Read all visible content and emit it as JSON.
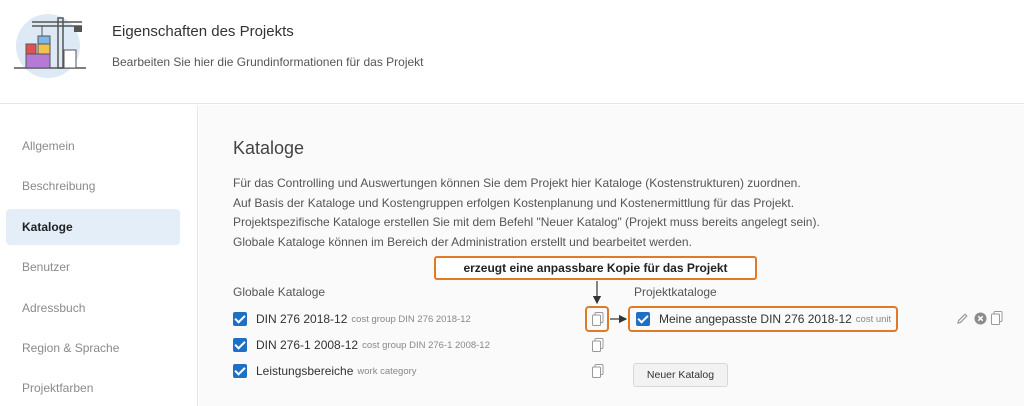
{
  "header": {
    "title": "Eigenschaften des Projekts",
    "subtitle": "Bearbeiten Sie hier die Grundinformationen für das Projekt"
  },
  "sidebar": {
    "items": [
      {
        "label": "Allgemein",
        "active": false
      },
      {
        "label": "Beschreibung",
        "active": false
      },
      {
        "label": "Kataloge",
        "active": true
      },
      {
        "label": "Benutzer",
        "active": false
      },
      {
        "label": "Adressbuch",
        "active": false
      },
      {
        "label": "Region & Sprache",
        "active": false
      },
      {
        "label": "Projektfarben",
        "active": false
      }
    ]
  },
  "main": {
    "title": "Kataloge",
    "description": [
      "Für das Controlling und Auswertungen können Sie dem Projekt hier Kataloge (Kostenstrukturen) zuordnen.",
      "Auf Basis der Kataloge und Kostengruppen erfolgen Kostenplanung und Kostenermittlung für das Projekt.",
      "Projektspezifische Kataloge erstellen Sie mit dem Befehl \"Neuer Katalog\" (Projekt muss bereits angelegt sein).",
      "Globale Kataloge können im Bereich der Administration erstellt und bearbeitet werden."
    ],
    "global_heading": "Globale Kataloge",
    "project_heading": "Projektkataloge",
    "global_catalogs": [
      {
        "name": "DIN 276 2018-12",
        "meta": "cost group DIN 276 2018-12",
        "checked": true
      },
      {
        "name": "DIN 276-1 2008-12",
        "meta": "cost group DIN 276-1 2008-12",
        "checked": true
      },
      {
        "name": "Leistungsbereiche",
        "meta": "work category",
        "checked": true
      }
    ],
    "project_catalogs": [
      {
        "name": "Meine angepasste DIN 276 2018-12",
        "meta": "cost unit",
        "checked": true
      }
    ],
    "new_catalog_button": "Neuer Katalog",
    "callout": "erzeugt eine anpassbare Kopie für das Projekt"
  },
  "colors": {
    "accent": "#1f6fc5",
    "highlight": "#e07a26",
    "active_bg": "#e3eef8"
  }
}
